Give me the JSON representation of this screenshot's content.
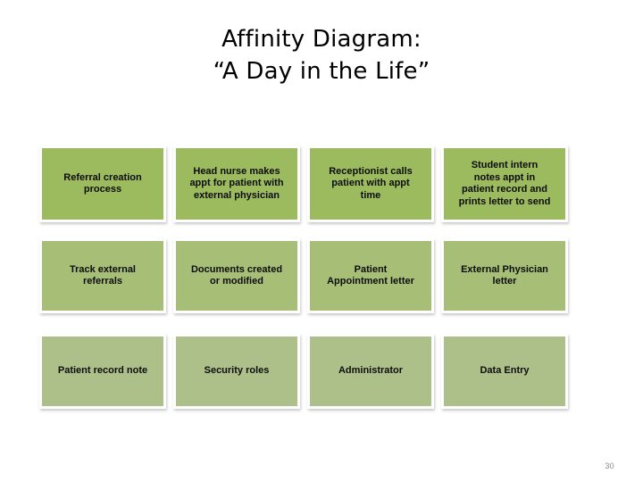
{
  "slide": {
    "title_line_1": "Affinity Diagram:",
    "title_line_2": "“A Day in the Life”",
    "page_number": "30",
    "background_color": "#ffffff"
  },
  "affinity": {
    "row_colors": [
      "#9cba5e",
      "#a7be77",
      "#aec089"
    ],
    "rows": [
      {
        "cards": [
          {
            "label": "Referral creation\nprocess"
          },
          {
            "label": "Head nurse makes\nappt for patient with\nexternal physician"
          },
          {
            "label": "Receptionist calls\npatient with appt\ntime"
          },
          {
            "label": "Student intern\nnotes appt in\npatient record and\nprints letter to send"
          }
        ]
      },
      {
        "cards": [
          {
            "label": "Track external\nreferrals"
          },
          {
            "label": "Documents created\nor modified"
          },
          {
            "label": "Patient\nAppointment letter"
          },
          {
            "label": "External Physician\nletter"
          }
        ]
      },
      {
        "cards": [
          {
            "label": "Patient record note"
          },
          {
            "label": "Security roles"
          },
          {
            "label": "Administrator"
          },
          {
            "label": "Data Entry"
          }
        ]
      }
    ]
  }
}
